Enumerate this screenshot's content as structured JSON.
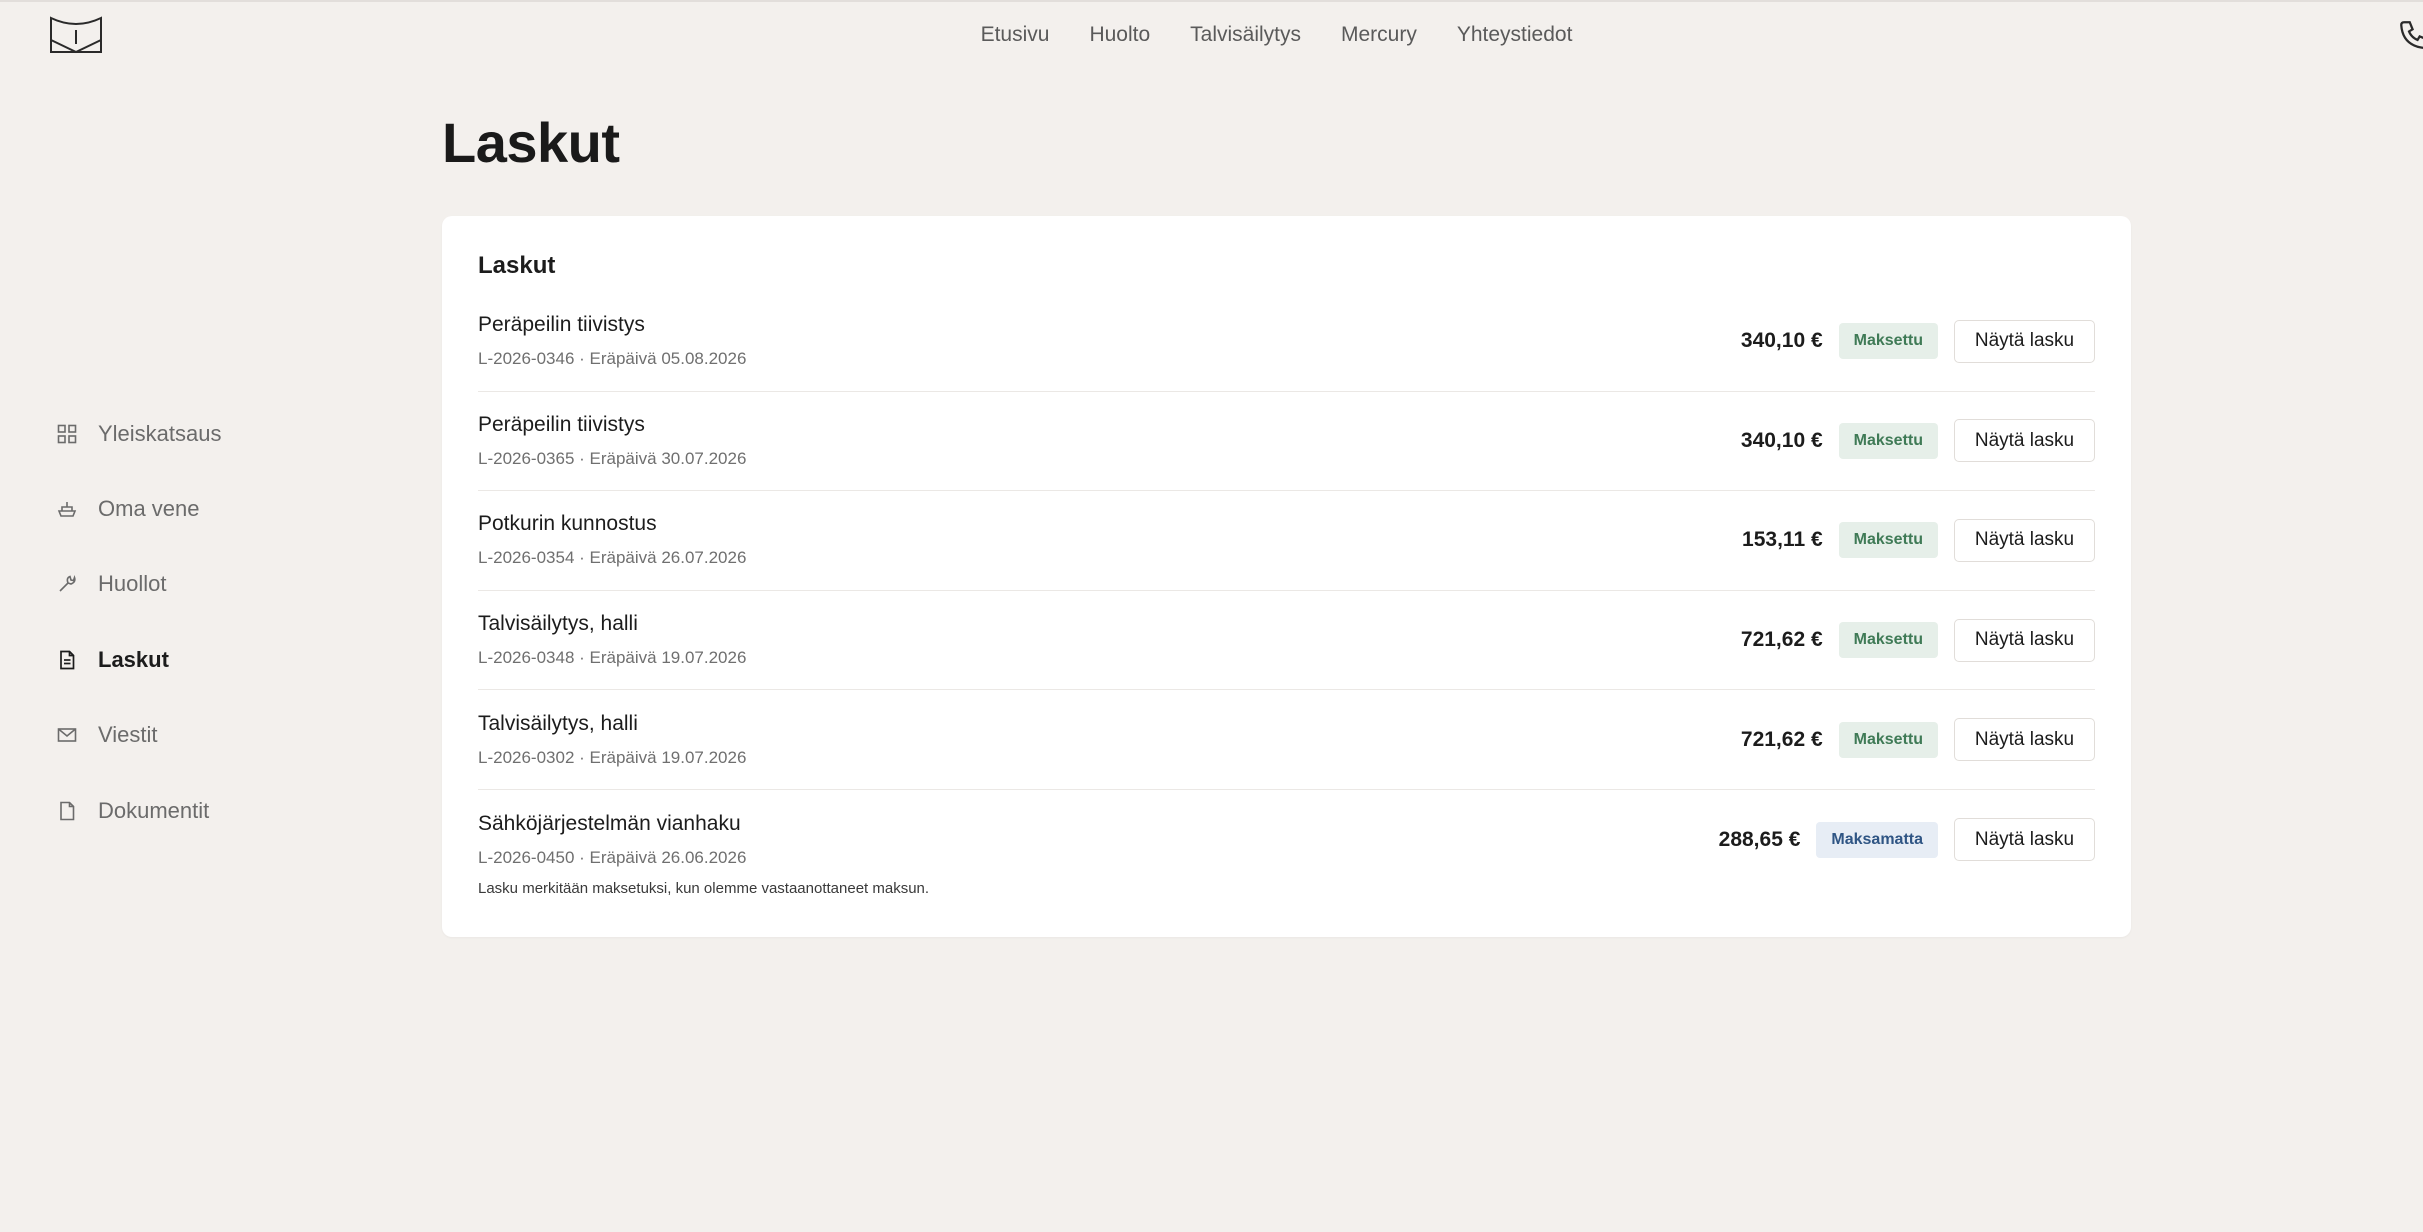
{
  "header": {
    "nav": [
      "Etusivu",
      "Huolto",
      "Talvisäilytys",
      "Mercury",
      "Yhteystiedot"
    ],
    "logo_icon": "boat-logo-icon",
    "phone_icon": "phone-icon"
  },
  "sidebar": {
    "items": [
      {
        "label": "Yleiskatsaus",
        "icon": "grid-icon",
        "active": false
      },
      {
        "label": "Oma vene",
        "icon": "boat-icon",
        "active": false
      },
      {
        "label": "Huollot",
        "icon": "wrench-icon",
        "active": false
      },
      {
        "label": "Laskut",
        "icon": "invoice-icon",
        "active": true
      },
      {
        "label": "Viestit",
        "icon": "mail-icon",
        "active": false
      },
      {
        "label": "Dokumentit",
        "icon": "file-icon",
        "active": false
      }
    ]
  },
  "page": {
    "title": "Laskut",
    "card_title": "Laskut",
    "footnote": "Lasku merkitään maksetuksi, kun olemme vastaanottaneet maksun.",
    "button_label": "Näytä lasku"
  },
  "invoices": [
    {
      "title": "Peräpeilin tiivistys",
      "meta": "L-2026-0346 · Eräpäivä 05.08.2026",
      "amount": "340,10 €",
      "status": "Maksettu",
      "status_type": "paid"
    },
    {
      "title": "Peräpeilin tiivistys",
      "meta": "L-2026-0365 · Eräpäivä 30.07.2026",
      "amount": "340,10 €",
      "status": "Maksettu",
      "status_type": "paid"
    },
    {
      "title": "Potkurin kunnostus",
      "meta": "L-2026-0354 · Eräpäivä 26.07.2026",
      "amount": "153,11 €",
      "status": "Maksettu",
      "status_type": "paid"
    },
    {
      "title": "Talvisäilytys, halli",
      "meta": "L-2026-0348 · Eräpäivä 19.07.2026",
      "amount": "721,62 €",
      "status": "Maksettu",
      "status_type": "paid"
    },
    {
      "title": "Talvisäilytys, halli",
      "meta": "L-2026-0302 · Eräpäivä 19.07.2026",
      "amount": "721,62 €",
      "status": "Maksettu",
      "status_type": "paid"
    },
    {
      "title": "Sähköjärjestelmän vianhaku",
      "meta": "L-2026-0450 · Eräpäivä 26.06.2026",
      "amount": "288,65 €",
      "status": "Maksamatta",
      "status_type": "unpaid"
    }
  ],
  "colors": {
    "background": "#f3f0ed",
    "card": "#ffffff",
    "paid_bg": "#e6efe9",
    "paid_text": "#3f7a56",
    "unpaid_bg": "#e7edf5",
    "unpaid_text": "#2f5584"
  }
}
